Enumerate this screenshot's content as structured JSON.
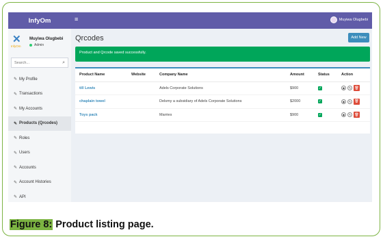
{
  "brand": {
    "logo_text": "InfyOm"
  },
  "header": {
    "menu_icon": "hamburger-icon",
    "user_name": "Muyiwa Olugbebi"
  },
  "sidebar": {
    "user": {
      "name": "Muyiwa Olugbebi",
      "role": "Admin",
      "logo_text": "InfyOm"
    },
    "search": {
      "placeholder": "Search..."
    },
    "items": [
      {
        "label": "My Profile",
        "active": false
      },
      {
        "label": "Transactions",
        "active": false
      },
      {
        "label": "My Accounts",
        "active": false
      },
      {
        "label": "Products (Qrcodes)",
        "active": true
      },
      {
        "label": "Roles",
        "active": false
      },
      {
        "label": "Users",
        "active": false
      },
      {
        "label": "Accounts",
        "active": false
      },
      {
        "label": "Account Histories",
        "active": false
      },
      {
        "label": "API",
        "active": false
      }
    ]
  },
  "main": {
    "title": "Qrcodes",
    "add_button": "Add New",
    "alert": "Product and Qrcode saved successfully.",
    "table": {
      "headers": [
        "Product Name",
        "Website",
        "Company Name",
        "Amount",
        "Status",
        "Action"
      ],
      "rows": [
        {
          "product": "till Lewis",
          "website": "",
          "company": "Adels Corporate Solutions",
          "amount": "$900"
        },
        {
          "product": "chaplain towel",
          "website": "",
          "company": "Delsmy a subsidiary of Adels Corporate Solutions",
          "amount": "$2000"
        },
        {
          "product": "Toys pack",
          "website": "",
          "company": "Marries",
          "amount": "$900"
        }
      ]
    }
  },
  "caption": {
    "figure": "Figure 8:",
    "text": " Product listing page."
  },
  "colors": {
    "topbar": "#605ca8",
    "success": "#00a65a",
    "primary": "#3c8dbc",
    "danger": "#dd4b39",
    "frame": "#7cb342"
  }
}
